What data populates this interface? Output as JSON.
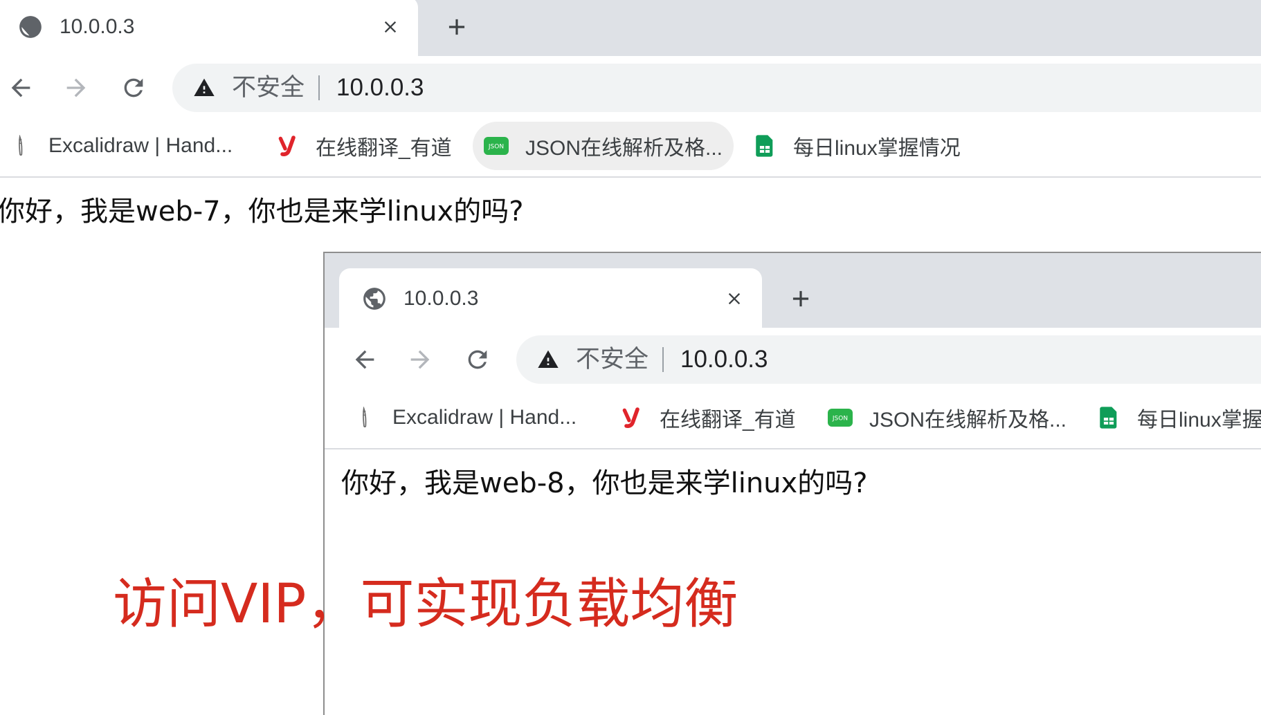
{
  "windows": [
    {
      "tab": {
        "title": "10.0.0.3",
        "favicon": "globe-icon"
      },
      "omnibox": {
        "security_icon": "warning-icon",
        "security_label": "不安全",
        "url": "10.0.0.3"
      },
      "bookmarks": [
        {
          "label": "Excalidraw | Hand...",
          "icon": "excalidraw-icon"
        },
        {
          "label": "在线翻译_有道",
          "icon": "youdao-icon"
        },
        {
          "label": "JSON在线解析及格...",
          "icon": "json-icon",
          "logo_text": "JSON",
          "hovered": true
        },
        {
          "label": "每日linux掌握情况",
          "icon": "sheets-icon"
        }
      ],
      "page_text": "你好，我是web-7，你也是来学linux的吗?"
    },
    {
      "tab": {
        "title": "10.0.0.3",
        "favicon": "globe-icon"
      },
      "omnibox": {
        "security_icon": "warning-icon",
        "security_label": "不安全",
        "url": "10.0.0.3"
      },
      "bookmarks": [
        {
          "label": "Excalidraw | Hand...",
          "icon": "excalidraw-icon"
        },
        {
          "label": "在线翻译_有道",
          "icon": "youdao-icon"
        },
        {
          "label": "JSON在线解析及格...",
          "icon": "json-icon",
          "logo_text": "JSON",
          "hovered": false
        },
        {
          "label": "每日linux掌握情况",
          "icon": "sheets-icon"
        }
      ],
      "page_text": "你好，我是web-8，你也是来学linux的吗?"
    }
  ],
  "caption": {
    "text": "访问VIP，可实现负载均衡"
  },
  "colors": {
    "tab_strip": "#dee1e6",
    "omnibox": "#f1f3f4",
    "caption": "#d52b1e",
    "text": "#202124",
    "json_icon": "#2bb34b",
    "sheets_icon": "#0f9d58",
    "youdao_icon": "#e0242b"
  }
}
